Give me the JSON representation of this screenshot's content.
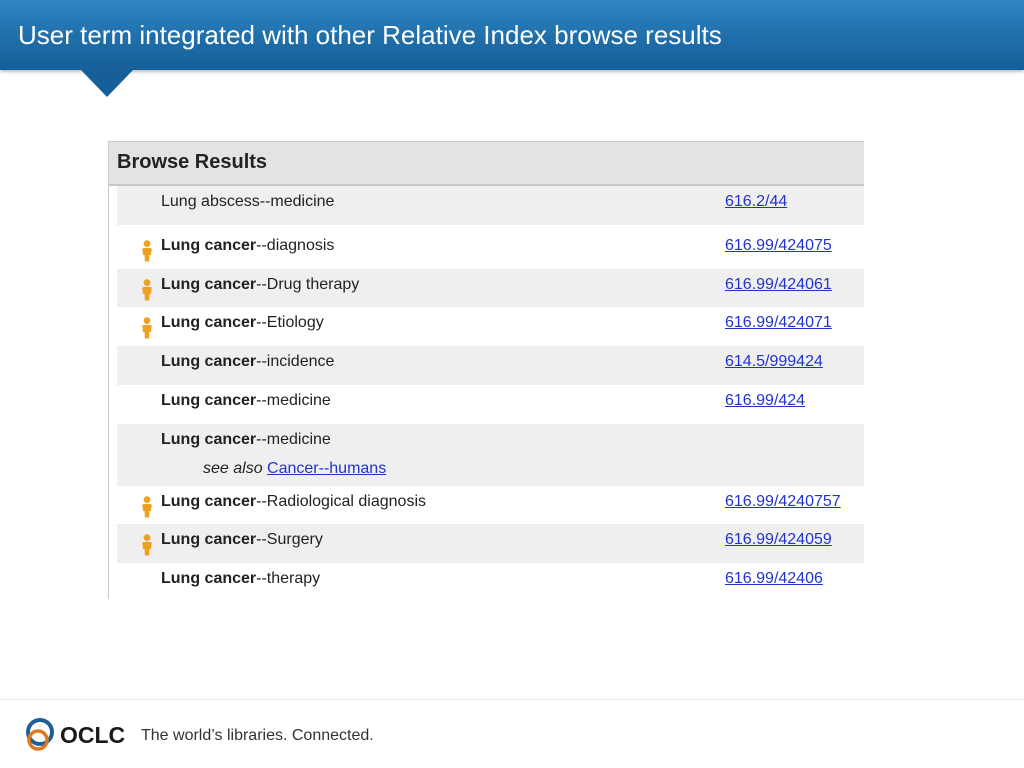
{
  "slide": {
    "title": "User term integrated with other Relative Index browse results"
  },
  "panel": {
    "header": "Browse Results",
    "rows": [
      {
        "bold": "",
        "rest": "Lung abscess--medicine",
        "number": "616.2/44",
        "user_icon": false,
        "shaded": true
      },
      {
        "bold": "Lung cancer",
        "rest": "--diagnosis",
        "number": "616.99/424075",
        "user_icon": true,
        "shaded": false
      },
      {
        "bold": "Lung cancer",
        "rest": "--Drug therapy",
        "number": "616.99/424061",
        "user_icon": true,
        "shaded": true
      },
      {
        "bold": "Lung cancer",
        "rest": "--Etiology",
        "number": "616.99/424071",
        "user_icon": true,
        "shaded": false
      },
      {
        "bold": "Lung cancer",
        "rest": "--incidence",
        "number": "614.5/999424",
        "user_icon": false,
        "shaded": true
      },
      {
        "bold": "Lung cancer",
        "rest": "--medicine",
        "number": "616.99/424",
        "user_icon": false,
        "shaded": false
      },
      {
        "bold": "Lung cancer",
        "rest": "--medicine",
        "number": "",
        "user_icon": false,
        "shaded": true,
        "see_also_label": "see also",
        "see_also_link": "Cancer--humans"
      },
      {
        "bold": "Lung cancer",
        "rest": "--Radiological diagnosis",
        "number": "616.99/4240757",
        "user_icon": true,
        "shaded": false
      },
      {
        "bold": "Lung cancer",
        "rest": "--Surgery",
        "number": "616.99/424059",
        "user_icon": true,
        "shaded": true
      },
      {
        "bold": "Lung cancer",
        "rest": "--therapy",
        "number": "616.99/42406",
        "user_icon": false,
        "shaded": false
      }
    ]
  },
  "footer": {
    "logo_text": "OCLC",
    "tagline": "The world’s libraries. Connected."
  },
  "colors": {
    "title_bar": "#1f6eaa",
    "link": "#2233cc",
    "user_icon": "#f0a020",
    "row_shade": "#efefef"
  },
  "icons": {
    "user_term": "person-icon",
    "logo": "oclc-logo-icon"
  }
}
